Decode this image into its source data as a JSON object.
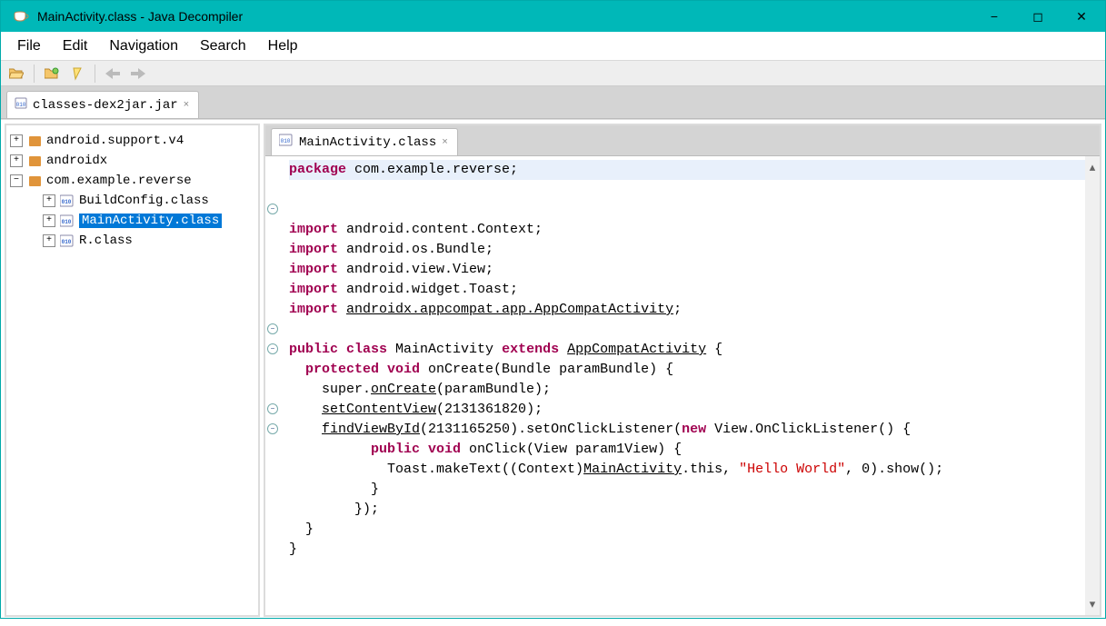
{
  "title": "MainActivity.class - Java Decompiler",
  "menus": [
    "File",
    "Edit",
    "Navigation",
    "Search",
    "Help"
  ],
  "window_controls": {
    "min": "−",
    "max": "◻",
    "close": "✕"
  },
  "toolbar": {
    "open": "Open",
    "open_type": "Open Type",
    "search": "Search",
    "back": "Back",
    "forward": "Forward"
  },
  "file_tab": {
    "label": "classes-dex2jar.jar",
    "close": "×"
  },
  "tree": {
    "items": [
      {
        "expand": "+",
        "depth": 0,
        "kind": "pkg",
        "label": "android.support.v4",
        "sel": false
      },
      {
        "expand": "+",
        "depth": 0,
        "kind": "pkg",
        "label": "androidx",
        "sel": false
      },
      {
        "expand": "−",
        "depth": 0,
        "kind": "pkg",
        "label": "com.example.reverse",
        "sel": false
      },
      {
        "expand": "+",
        "depth": 1,
        "kind": "cls",
        "label": "BuildConfig.class",
        "sel": false
      },
      {
        "expand": "+",
        "depth": 1,
        "kind": "cls",
        "label": "MainActivity.class",
        "sel": true
      },
      {
        "expand": "+",
        "depth": 1,
        "kind": "cls",
        "label": "R.class",
        "sel": false
      }
    ]
  },
  "code_tab": {
    "label": "MainActivity.class",
    "close": "×"
  },
  "code": {
    "l1_kw": "package",
    "l1_rest": " com.example.reverse;",
    "imp": "import",
    "im1": " android.content.Context;",
    "im2": " android.os.Bundle;",
    "im3": " android.view.View;",
    "im4": " android.widget.Toast;",
    "im5a": " ",
    "im5u": "androidx.appcompat.app.AppCompatActivity",
    "im5b": ";",
    "c1a": "public",
    "c1b": " class",
    "c1c": " MainActivity ",
    "c1d": "extends",
    "c1u": "AppCompatActivity",
    "c1e": " {",
    "c2a": "  protected",
    "c2b": " void",
    "c2c": " onCreate(Bundle paramBundle) {",
    "c3a": "    super.",
    "c3u": "onCreate",
    "c3b": "(paramBundle);",
    "c4a": "    ",
    "c4u": "setContentView",
    "c4b": "(2131361820);",
    "c5a": "    ",
    "c5u": "findViewById",
    "c5b": "(2131165250).setOnClickListener(",
    "c5n": "new",
    "c5c": " View.OnClickListener() {",
    "c6a": "          public",
    "c6b": " void",
    "c6c": " onClick(View param1View) {",
    "c7a": "            Toast.makeText((Context)",
    "c7u": "MainActivity",
    "c7b": ".this, ",
    "c7s": "\"Hello World\"",
    "c7c": ", 0).show();",
    "c8": "          }",
    "c9": "        });",
    "c10": "  }",
    "c11": "}"
  },
  "fold_marks": {
    "plus": "+",
    "minus": "−"
  }
}
